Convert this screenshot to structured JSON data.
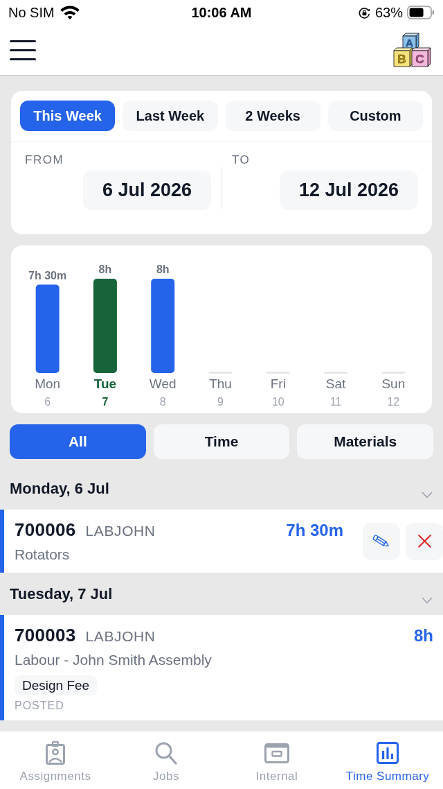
{
  "status_bar": {
    "carrier": "No SIM",
    "time": "10:06 AM",
    "battery": "63%"
  },
  "header": {
    "logo_letters": [
      "A",
      "B",
      "C"
    ]
  },
  "range_tabs": [
    {
      "label": "This Week",
      "selected": true
    },
    {
      "label": "Last Week",
      "selected": false
    },
    {
      "label": "2 Weeks",
      "selected": false
    },
    {
      "label": "Custom",
      "selected": false
    }
  ],
  "date_range": {
    "from_label": "FROM",
    "from": "6 Jul 2026",
    "to_label": "TO",
    "to": "12 Jul 2026"
  },
  "chart": {
    "chart_data": {
      "type": "bar",
      "categories": [
        "Mon",
        "Tue",
        "Wed",
        "Thu",
        "Fri",
        "Sat",
        "Sun"
      ],
      "values": [
        7.5,
        8,
        8,
        0,
        0,
        0,
        0
      ],
      "value_labels": [
        "7h 30m",
        "8h",
        "8h",
        null,
        null,
        null,
        null
      ]
    },
    "days": [
      {
        "date": "6",
        "selected": false,
        "color": "#2563eb"
      },
      {
        "date": "7",
        "selected": true,
        "color": "#17633a"
      },
      {
        "date": "8",
        "selected": false,
        "color": "#2563eb"
      },
      {
        "date": "9",
        "selected": false
      },
      {
        "date": "10",
        "selected": false
      },
      {
        "date": "11",
        "selected": false
      },
      {
        "date": "12",
        "selected": false
      }
    ]
  },
  "filters": [
    {
      "label": "All",
      "selected": true
    },
    {
      "label": "Time",
      "selected": false
    },
    {
      "label": "Materials",
      "selected": false
    }
  ],
  "groups": [
    {
      "title": "Monday, 6 Jul",
      "entries": [
        {
          "job": "700006",
          "user": "LABJOHN",
          "duration": "7h 30m",
          "description": "Rotators",
          "editable": true
        }
      ]
    },
    {
      "title": "Tuesday, 7 Jul",
      "entries": [
        {
          "job": "700003",
          "user": "LABJOHN",
          "duration": "8h",
          "description": "Labour - John Smith Assembly",
          "tags": [
            "Design Fee"
          ],
          "status": "POSTED",
          "editable": false
        }
      ]
    }
  ],
  "tab_bar": [
    {
      "label": "Assignments",
      "selected": false
    },
    {
      "label": "Jobs",
      "selected": false
    },
    {
      "label": "Internal",
      "selected": false
    },
    {
      "label": "Time Summary",
      "selected": true
    }
  ]
}
